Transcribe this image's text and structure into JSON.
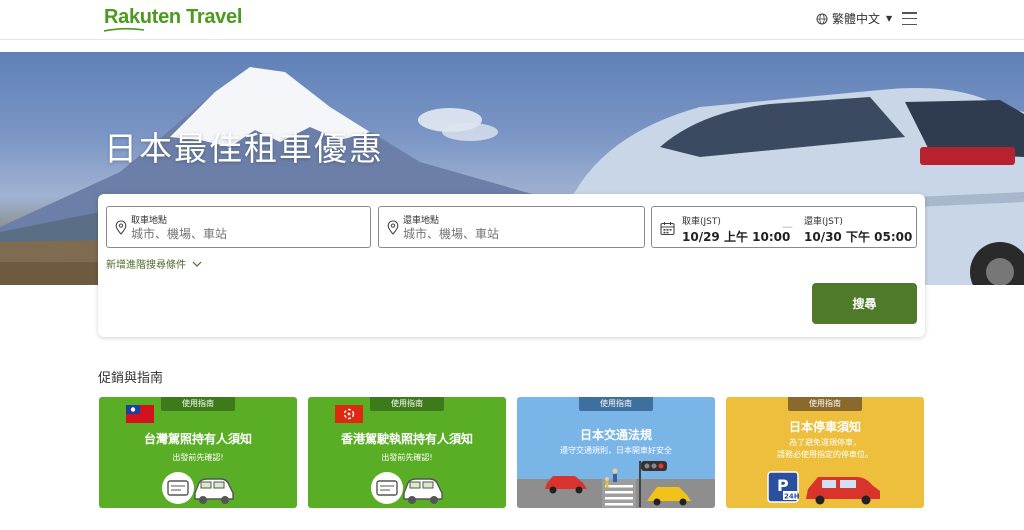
{
  "header": {
    "logo": "Rakuten Travel",
    "language": "繁體中文"
  },
  "hero": {
    "title": "日本最佳租車優惠"
  },
  "search": {
    "pickup_label": "取車地點",
    "pickup_placeholder": "城市、機場、車站",
    "return_label": "還車地點",
    "return_placeholder": "城市、機場、車站",
    "pickup_time_label": "取車(JST)",
    "pickup_time_value": "10/29 上午 10:00",
    "return_time_label": "還車(JST)",
    "return_time_value": "10/30 下午 05:00",
    "dash": "—",
    "advanced_label": "新增進階搜尋條件",
    "search_button": "搜尋"
  },
  "promos": {
    "section_title": "促銷與指南",
    "items": [
      {
        "tag": "使用指南",
        "title": "台灣駕照持有人須知",
        "subtitle": "出發前先確認!"
      },
      {
        "tag": "使用指南",
        "title": "香港駕駛執照持有人須知",
        "subtitle": "出發前先確認!"
      },
      {
        "tag": "使用指南",
        "title": "日本交通法規",
        "subtitle": "遵守交通規則，日本開車好安全"
      },
      {
        "tag": "使用指南",
        "title": "日本停車須知",
        "subtitle": "為了避免違規停車，",
        "subtitle2": "請務必使用指定的停車位。"
      }
    ]
  },
  "colors": {
    "brand_green": "#4a9a1e",
    "button_green": "#4f7a2a",
    "promo_green": "#5aae26",
    "promo_blue": "#7ab5e8",
    "promo_yellow": "#eebf3c"
  }
}
